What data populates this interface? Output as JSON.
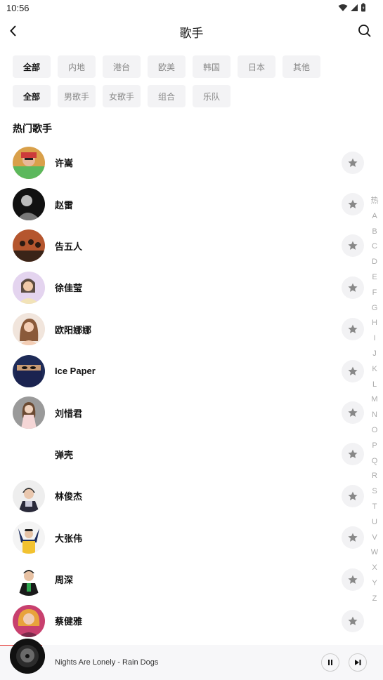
{
  "status": {
    "time": "10:56"
  },
  "header": {
    "title": "歌手"
  },
  "filters": {
    "region": [
      {
        "label": "全部",
        "active": true
      },
      {
        "label": "内地",
        "active": false
      },
      {
        "label": "港台",
        "active": false
      },
      {
        "label": "欧美",
        "active": false
      },
      {
        "label": "韩国",
        "active": false
      },
      {
        "label": "日本",
        "active": false
      },
      {
        "label": "其他",
        "active": false
      }
    ],
    "type": [
      {
        "label": "全部",
        "active": true
      },
      {
        "label": "男歌手",
        "active": false
      },
      {
        "label": "女歌手",
        "active": false
      },
      {
        "label": "组合",
        "active": false
      },
      {
        "label": "乐队",
        "active": false
      }
    ]
  },
  "section": {
    "title": "热门歌手"
  },
  "artists": [
    {
      "name": "许嵩",
      "avatar": "avatar-1"
    },
    {
      "name": "赵雷",
      "avatar": "avatar-2"
    },
    {
      "name": "告五人",
      "avatar": "avatar-3"
    },
    {
      "name": "徐佳莹",
      "avatar": "avatar-4"
    },
    {
      "name": "欧阳娜娜",
      "avatar": "avatar-5"
    },
    {
      "name": "Ice Paper",
      "avatar": "avatar-6"
    },
    {
      "name": "刘惜君",
      "avatar": "avatar-7"
    },
    {
      "name": "弹壳",
      "avatar": "none"
    },
    {
      "name": "林俊杰",
      "avatar": "avatar-9"
    },
    {
      "name": "大张伟",
      "avatar": "avatar-10"
    },
    {
      "name": "周深",
      "avatar": "avatar-11"
    },
    {
      "name": "蔡健雅",
      "avatar": "avatar-12"
    }
  ],
  "index": [
    "热",
    "A",
    "B",
    "C",
    "D",
    "E",
    "F",
    "G",
    "H",
    "I",
    "J",
    "K",
    "L",
    "M",
    "N",
    "O",
    "P",
    "Q",
    "R",
    "S",
    "T",
    "U",
    "V",
    "W",
    "X",
    "Y",
    "Z"
  ],
  "player": {
    "song": "Nights Are Lonely - Rain Dogs"
  },
  "colors": {
    "accent": "#e53935",
    "chip_bg": "#f3f3f5",
    "fav_bg": "#f2f2f4"
  }
}
